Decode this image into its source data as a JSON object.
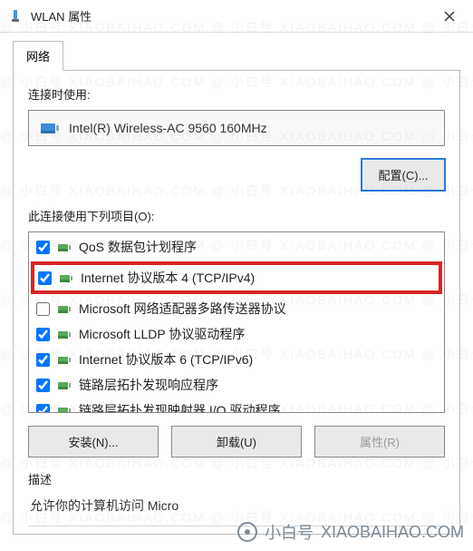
{
  "window": {
    "title": "WLAN 属性"
  },
  "tab": {
    "label": "网络"
  },
  "connect": {
    "label": "连接时使用:",
    "adapter": "Intel(R) Wireless-AC 9560 160MHz",
    "configure_btn": "配置(C)..."
  },
  "items_label": "此连接使用下列项目(O):",
  "items": [
    {
      "checked": true,
      "label": "QoS 数据包计划程序"
    },
    {
      "checked": true,
      "label": "Internet 协议版本 4 (TCP/IPv4)",
      "highlight": true
    },
    {
      "checked": false,
      "label": "Microsoft 网络适配器多路传送器协议"
    },
    {
      "checked": true,
      "label": "Microsoft LLDP 协议驱动程序"
    },
    {
      "checked": true,
      "label": "Internet 协议版本 6 (TCP/IPv6)"
    },
    {
      "checked": true,
      "label": "链路层拓扑发现响应程序"
    },
    {
      "checked": true,
      "label": "链路层拓扑发现映射器 I/O 驱动程序"
    }
  ],
  "buttons": {
    "install": "安装(N)...",
    "uninstall": "卸载(U)",
    "properties": "属性(R)"
  },
  "description": {
    "label": "描述",
    "body": "允许你的计算机访问 Micro"
  },
  "watermark": {
    "line": "@ 小白号   XIAOBAIHAO.COM   @ 小白号   XIAOBAIHAO.COM   @ 小白号   XIAOBAIHAO.COM",
    "brand": "小白号",
    "site": "XIAOBAIHAO.COM"
  }
}
